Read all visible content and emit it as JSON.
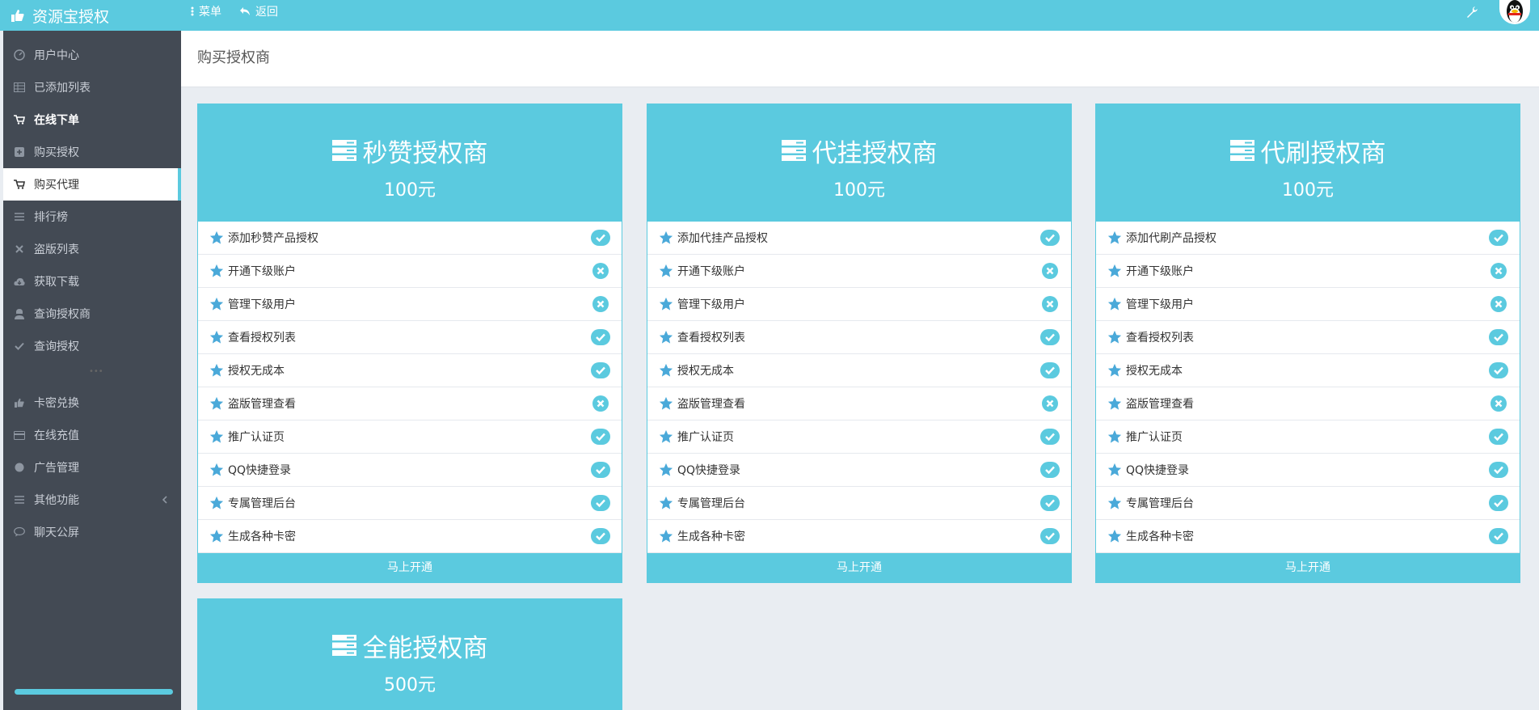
{
  "app": {
    "title": "资源宝授权"
  },
  "topbar": {
    "menu_label": "菜单",
    "back_label": "返回"
  },
  "sidebar": {
    "items": [
      {
        "label": "用户中心",
        "icon": "dashboard-icon"
      },
      {
        "label": "已添加列表",
        "icon": "table-icon"
      },
      {
        "label": "在线下单",
        "icon": "cart-icon"
      },
      {
        "label": "购买授权",
        "icon": "plus-square-icon"
      },
      {
        "label": "购买代理",
        "icon": "cart-icon"
      },
      {
        "label": "排行榜",
        "icon": "list-icon"
      },
      {
        "label": "盗版列表",
        "icon": "close-icon"
      },
      {
        "label": "获取下载",
        "icon": "cloud-download-icon"
      },
      {
        "label": "查询授权商",
        "icon": "user-secret-icon"
      },
      {
        "label": "查询授权",
        "icon": "check-icon"
      },
      {
        "label": "卡密兑换",
        "icon": "thumbs-up-icon"
      },
      {
        "label": "在线充值",
        "icon": "credit-card-icon"
      },
      {
        "label": "广告管理",
        "icon": "circle-icon"
      },
      {
        "label": "其他功能",
        "icon": "list-icon"
      },
      {
        "label": "聊天公屏",
        "icon": "chat-icon"
      }
    ]
  },
  "page": {
    "title": "购买授权商"
  },
  "cards": [
    {
      "title": "秒赞授权商",
      "price": "100元",
      "button": "马上开通",
      "features": [
        {
          "label": "添加秒赞产品授权",
          "ok": true
        },
        {
          "label": "开通下级账户",
          "ok": false
        },
        {
          "label": "管理下级用户",
          "ok": false
        },
        {
          "label": "查看授权列表",
          "ok": true
        },
        {
          "label": "授权无成本",
          "ok": true
        },
        {
          "label": "盗版管理查看",
          "ok": false
        },
        {
          "label": "推广认证页",
          "ok": true
        },
        {
          "label": "QQ快捷登录",
          "ok": true
        },
        {
          "label": "专属管理后台",
          "ok": true
        },
        {
          "label": "生成各种卡密",
          "ok": true
        }
      ]
    },
    {
      "title": "代挂授权商",
      "price": "100元",
      "button": "马上开通",
      "features": [
        {
          "label": "添加代挂产品授权",
          "ok": true
        },
        {
          "label": "开通下级账户",
          "ok": false
        },
        {
          "label": "管理下级用户",
          "ok": false
        },
        {
          "label": "查看授权列表",
          "ok": true
        },
        {
          "label": "授权无成本",
          "ok": true
        },
        {
          "label": "盗版管理查看",
          "ok": false
        },
        {
          "label": "推广认证页",
          "ok": true
        },
        {
          "label": "QQ快捷登录",
          "ok": true
        },
        {
          "label": "专属管理后台",
          "ok": true
        },
        {
          "label": "生成各种卡密",
          "ok": true
        }
      ]
    },
    {
      "title": "代刷授权商",
      "price": "100元",
      "button": "马上开通",
      "features": [
        {
          "label": "添加代刷产品授权",
          "ok": true
        },
        {
          "label": "开通下级账户",
          "ok": false
        },
        {
          "label": "管理下级用户",
          "ok": false
        },
        {
          "label": "查看授权列表",
          "ok": true
        },
        {
          "label": "授权无成本",
          "ok": true
        },
        {
          "label": "盗版管理查看",
          "ok": false
        },
        {
          "label": "推广认证页",
          "ok": true
        },
        {
          "label": "QQ快捷登录",
          "ok": true
        },
        {
          "label": "专属管理后台",
          "ok": true
        },
        {
          "label": "生成各种卡密",
          "ok": true
        }
      ]
    },
    {
      "title": "全能授权商",
      "price": "500元"
    }
  ],
  "colors": {
    "accent": "#5bcadf",
    "sidebar_bg": "#434a54",
    "page_bg": "#e9edf2",
    "star": "#4aa9d9"
  }
}
